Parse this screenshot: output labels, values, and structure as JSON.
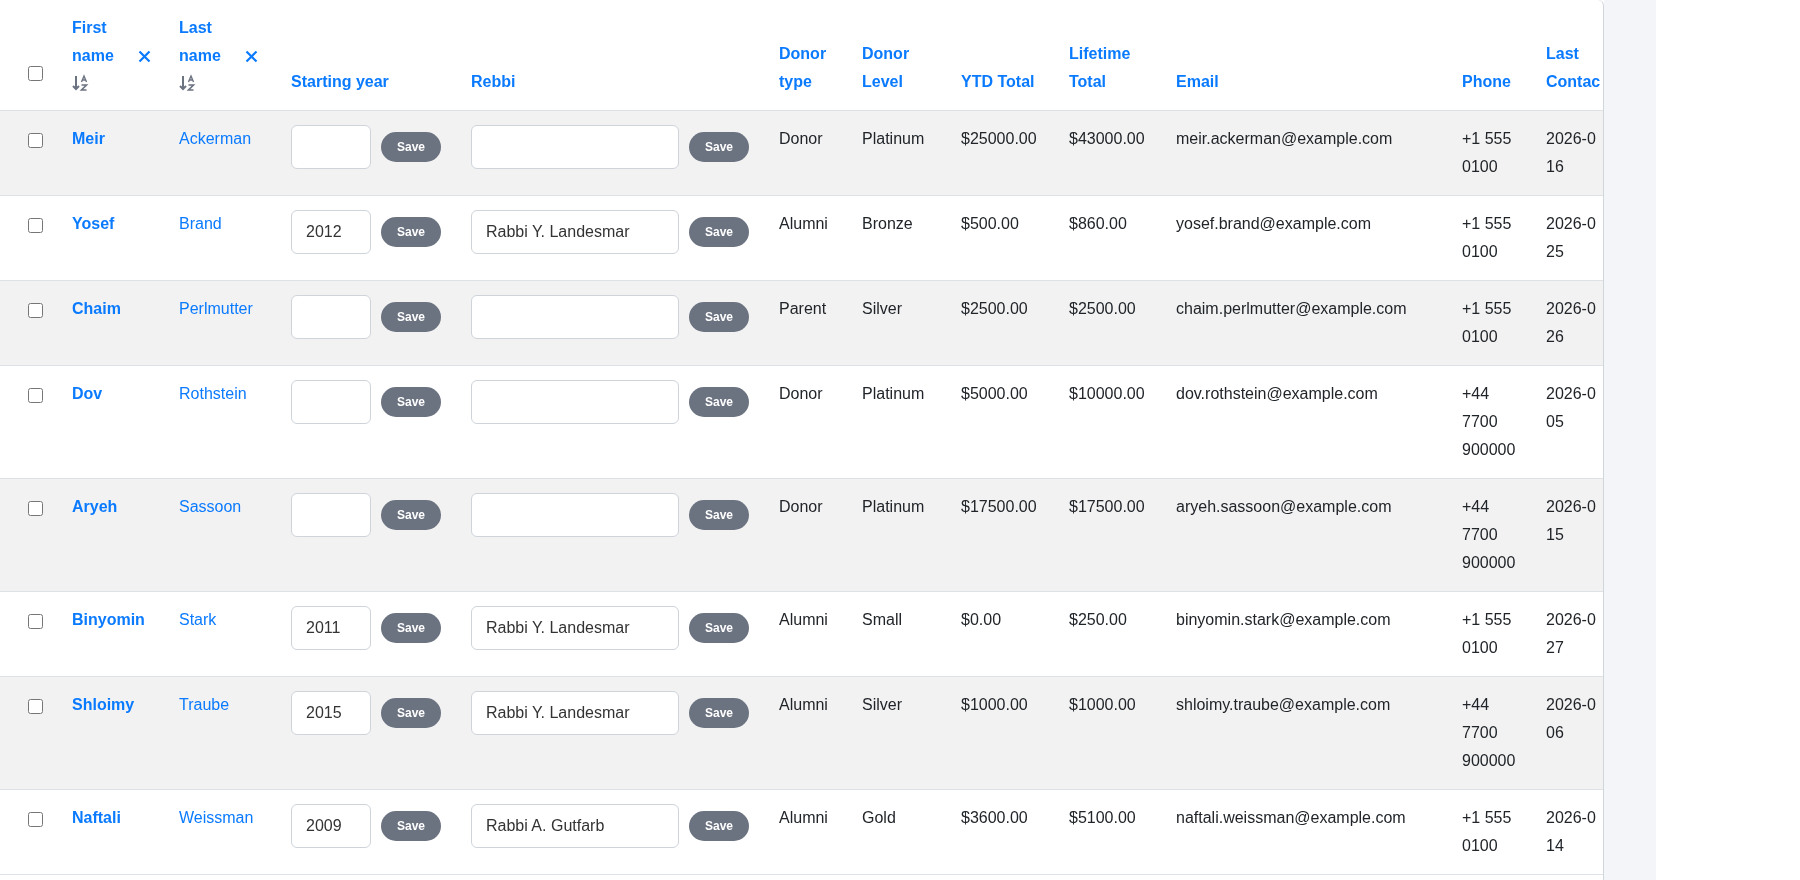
{
  "table": {
    "select_all": false,
    "columns": [
      {
        "label": "First name",
        "sortable": true,
        "clearable": true
      },
      {
        "label": "Last name",
        "sortable": true,
        "clearable": true
      },
      {
        "label": "Starting year"
      },
      {
        "label": "Rebbi"
      },
      {
        "label": "Donor type"
      },
      {
        "label": "Donor Level"
      },
      {
        "label": "YTD Total"
      },
      {
        "label": "Lifetime Total"
      },
      {
        "label": "Email"
      },
      {
        "label": "Phone"
      },
      {
        "label": "Last Contac"
      }
    ],
    "rows": [
      {
        "selected": false,
        "first_name": "Meir",
        "last_name": "Ackerman",
        "year_save": "Save",
        "rebbi_save": "Save",
        "donor_type": "Donor",
        "donor_level": "Platinum",
        "ytd_total": "$25000.00",
        "lifetime_total": "$43000.00",
        "email": "meir.ackerman@example.com",
        "phone": "+1 555 0100",
        "last_contact": "2026-0 16"
      },
      {
        "selected": false,
        "first_name": "Yosef",
        "last_name": "Brand",
        "starting_year": "2012",
        "year_save": "Save",
        "rebbi": "Rabbi Y. Landesmar",
        "rebbi_save": "Save",
        "donor_type": "Alumni",
        "donor_level": "Bronze",
        "ytd_total": "$500.00",
        "lifetime_total": "$860.00",
        "email": "yosef.brand@example.com",
        "phone": "+1 555 0100",
        "last_contact": "2026-0 25"
      },
      {
        "selected": false,
        "first_name": "Chaim",
        "last_name": "Perlmutter",
        "year_save": "Save",
        "rebbi_save": "Save",
        "donor_type": "Parent",
        "donor_level": "Silver",
        "ytd_total": "$2500.00",
        "lifetime_total": "$2500.00",
        "email": "chaim.perlmutter@example.com",
        "phone": "+1 555 0100",
        "last_contact": "2026-0 26"
      },
      {
        "selected": false,
        "first_name": "Dov",
        "last_name": "Rothstein",
        "year_save": "Save",
        "rebbi_save": "Save",
        "donor_type": "Donor",
        "donor_level": "Platinum",
        "ytd_total": "$5000.00",
        "lifetime_total": "$10000.00",
        "email": "dov.rothstein@example.com",
        "phone": "+44 7700 900000",
        "last_contact": "2026-0 05"
      },
      {
        "selected": false,
        "first_name": "Aryeh",
        "last_name": "Sassoon",
        "year_save": "Save",
        "rebbi_save": "Save",
        "donor_type": "Donor",
        "donor_level": "Platinum",
        "ytd_total": "$17500.00",
        "lifetime_total": "$17500.00",
        "email": "aryeh.sassoon@example.com",
        "phone": "+44 7700 900000",
        "last_contact": "2026-0 15"
      },
      {
        "selected": false,
        "first_name": "Binyomin",
        "last_name": "Stark",
        "starting_year": "2011",
        "year_save": "Save",
        "rebbi": "Rabbi Y. Landesmar",
        "rebbi_save": "Save",
        "donor_type": "Alumni",
        "donor_level": "Small",
        "ytd_total": "$0.00",
        "lifetime_total": "$250.00",
        "email": "binyomin.stark@example.com",
        "phone": "+1 555 0100",
        "last_contact": "2026-0 27"
      },
      {
        "selected": false,
        "first_name": "Shloimy",
        "last_name": "Traube",
        "starting_year": "2015",
        "year_save": "Save",
        "rebbi": "Rabbi Y. Landesmar",
        "rebbi_save": "Save",
        "donor_type": "Alumni",
        "donor_level": "Silver",
        "ytd_total": "$1000.00",
        "lifetime_total": "$1000.00",
        "email": "shloimy.traube@example.com",
        "phone": "+44 7700 900000",
        "last_contact": "2026-0 06"
      },
      {
        "selected": false,
        "first_name": "Naftali",
        "last_name": "Weissman",
        "starting_year": "2009",
        "year_save": "Save",
        "rebbi": "Rabbi A. Gutfarb",
        "rebbi_save": "Save",
        "donor_type": "Alumni",
        "donor_level": "Gold",
        "ytd_total": "$3600.00",
        "lifetime_total": "$5100.00",
        "email": "naftali.weissman@example.com",
        "phone": "+1 555 0100",
        "last_contact": "2026-0 14"
      }
    ]
  }
}
